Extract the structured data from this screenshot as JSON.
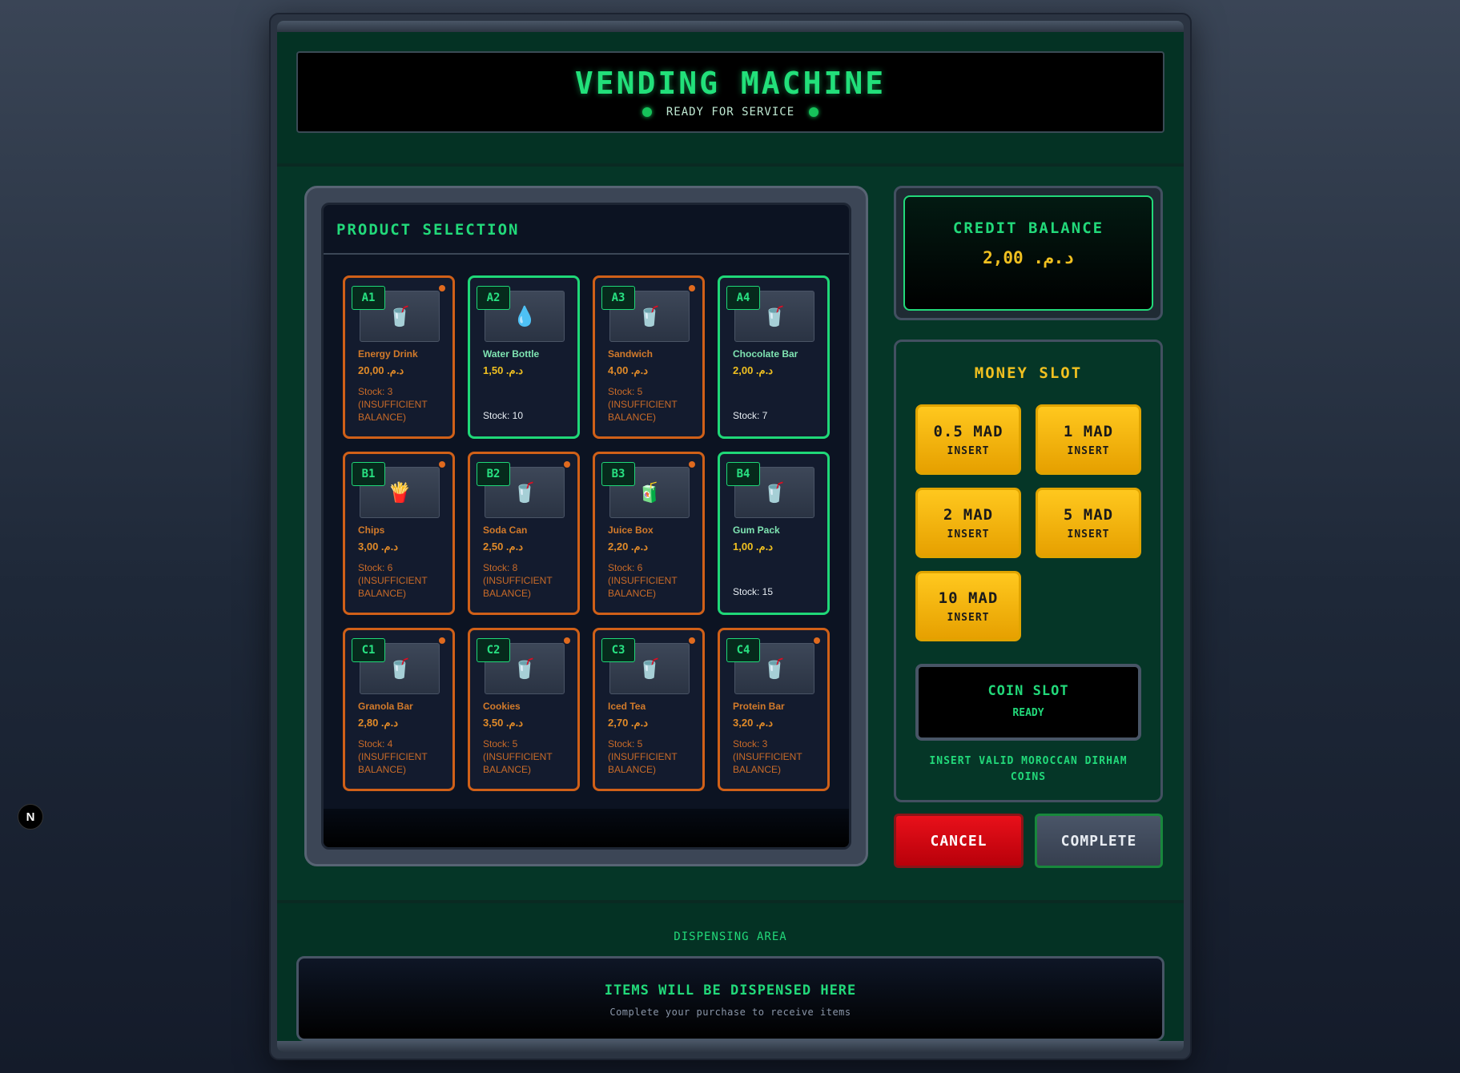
{
  "header": {
    "title": "VENDING MACHINE",
    "status": "READY FOR SERVICE"
  },
  "products": {
    "title": "PRODUCT SELECTION",
    "items": [
      {
        "code": "A1",
        "name": "Energy Drink",
        "price": "د.م.‏ 20,00",
        "stock": "Stock: 3",
        "note": "(INSUFFICIENT BALANCE)",
        "icon": "cup-icon",
        "glyph": "🥤"
      },
      {
        "code": "A2",
        "name": "Water Bottle",
        "price": "د.م.‏ 1,50",
        "stock": "Stock: 10",
        "note": "",
        "icon": "water-drop-icon",
        "glyph": "💧"
      },
      {
        "code": "A3",
        "name": "Sandwich",
        "price": "د.م.‏ 4,00",
        "stock": "Stock: 5",
        "note": "(INSUFFICIENT BALANCE)",
        "icon": "cup-icon",
        "glyph": "🥤"
      },
      {
        "code": "A4",
        "name": "Chocolate Bar",
        "price": "د.م.‏ 2,00",
        "stock": "Stock: 7",
        "note": "",
        "icon": "cup-icon",
        "glyph": "🥤"
      },
      {
        "code": "B1",
        "name": "Chips",
        "price": "د.م.‏ 3,00",
        "stock": "Stock: 6",
        "note": "(INSUFFICIENT BALANCE)",
        "icon": "fries-icon",
        "glyph": "🍟"
      },
      {
        "code": "B2",
        "name": "Soda Can",
        "price": "د.م.‏ 2,50",
        "stock": "Stock: 8",
        "note": "(INSUFFICIENT BALANCE)",
        "icon": "cup-icon",
        "glyph": "🥤"
      },
      {
        "code": "B3",
        "name": "Juice Box",
        "price": "د.م.‏ 2,20",
        "stock": "Stock: 6",
        "note": "(INSUFFICIENT BALANCE)",
        "icon": "juice-box-icon",
        "glyph": "🧃"
      },
      {
        "code": "B4",
        "name": "Gum Pack",
        "price": "د.م.‏ 1,00",
        "stock": "Stock: 15",
        "note": "",
        "icon": "cup-icon",
        "glyph": "🥤"
      },
      {
        "code": "C1",
        "name": "Granola Bar",
        "price": "د.م.‏ 2,80",
        "stock": "Stock: 4",
        "note": "(INSUFFICIENT BALANCE)",
        "icon": "cup-icon",
        "glyph": "🥤"
      },
      {
        "code": "C2",
        "name": "Cookies",
        "price": "د.م.‏ 3,50",
        "stock": "Stock: 5",
        "note": "(INSUFFICIENT BALANCE)",
        "icon": "cup-icon",
        "glyph": "🥤"
      },
      {
        "code": "C3",
        "name": "Iced Tea",
        "price": "د.م.‏ 2,70",
        "stock": "Stock: 5",
        "note": "(INSUFFICIENT BALANCE)",
        "icon": "cup-icon",
        "glyph": "🥤"
      },
      {
        "code": "C4",
        "name": "Protein Bar",
        "price": "د.م.‏ 3,20",
        "stock": "Stock: 3",
        "note": "(INSUFFICIENT BALANCE)",
        "icon": "cup-icon",
        "glyph": "🥤"
      }
    ]
  },
  "credit": {
    "title": "CREDIT BALANCE",
    "value": "2,00 د.م.‏"
  },
  "money": {
    "title": "MONEY SLOT",
    "coins": [
      {
        "amount": "0.5 MAD",
        "label": "INSERT"
      },
      {
        "amount": "1 MAD",
        "label": "INSERT"
      },
      {
        "amount": "2 MAD",
        "label": "INSERT"
      },
      {
        "amount": "5 MAD",
        "label": "INSERT"
      },
      {
        "amount": "10 MAD",
        "label": "INSERT"
      }
    ],
    "slot_title": "COIN SLOT",
    "slot_status": "READY",
    "note": "INSERT VALID MOROCCAN DIRHAM COINS"
  },
  "actions": {
    "cancel": "CANCEL",
    "complete": "COMPLETE"
  },
  "dispense": {
    "label": "DISPENSING AREA",
    "title": "ITEMS WILL BE DISPENSED HERE",
    "subtitle": "Complete your purchase to receive items"
  },
  "badge": {
    "letter": "N"
  },
  "colors": {
    "accent_green": "#22d97a",
    "accent_yellow": "#f0c020",
    "warning_orange": "#d06018",
    "cancel_red": "#e8101a"
  }
}
